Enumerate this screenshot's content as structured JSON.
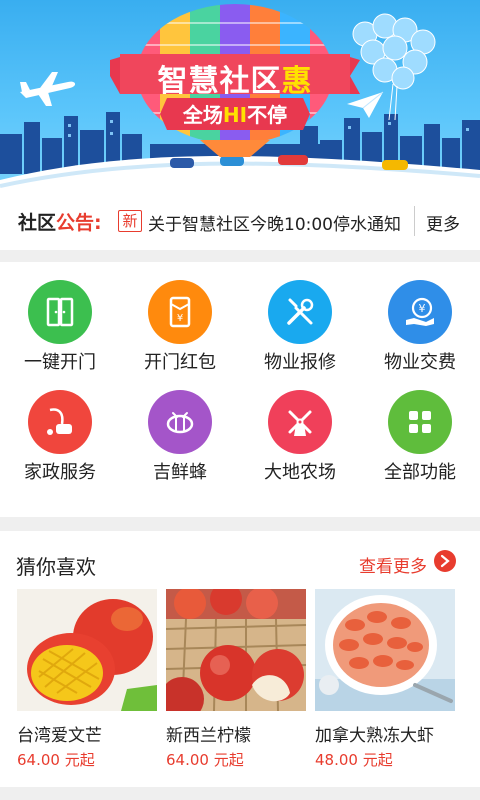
{
  "banner": {
    "title_main": "智慧社区",
    "title_highlight": "惠",
    "subtitle_pre": "全场",
    "subtitle_highlight": "HI",
    "subtitle_post": "不停"
  },
  "notice": {
    "label_black": "社区",
    "label_red": "公告:",
    "tag": "新",
    "message": "关于智慧社区今晚10:00停水通知",
    "more": "更多"
  },
  "services": [
    {
      "label": "一键开门",
      "icon": "door-icon",
      "color": "#3cbf4f"
    },
    {
      "label": "开门红包",
      "icon": "red-envelope-icon",
      "color": "#ff8a0d"
    },
    {
      "label": "物业报修",
      "icon": "repair-tools-icon",
      "color": "#19a9ef"
    },
    {
      "label": "物业交费",
      "icon": "payment-icon",
      "color": "#2f8ee8"
    },
    {
      "label": "家政服务",
      "icon": "vacuum-cleaner-icon",
      "color": "#f0463d"
    },
    {
      "label": "吉鲜蜂",
      "icon": "bee-icon",
      "color": "#a455c9"
    },
    {
      "label": "大地农场",
      "icon": "windmill-icon",
      "color": "#f0405a"
    },
    {
      "label": "全部功能",
      "icon": "grid-icon",
      "color": "#5fbd3c"
    }
  ],
  "guess": {
    "title": "猜你喜欢",
    "more": "查看更多",
    "products": [
      {
        "name": "台湾爱文芒",
        "price": "64.00 元起"
      },
      {
        "name": "新西兰柠檬",
        "price": "64.00 元起"
      },
      {
        "name": "加拿大熟冻大虾",
        "price": "48.00 元起"
      }
    ]
  }
}
